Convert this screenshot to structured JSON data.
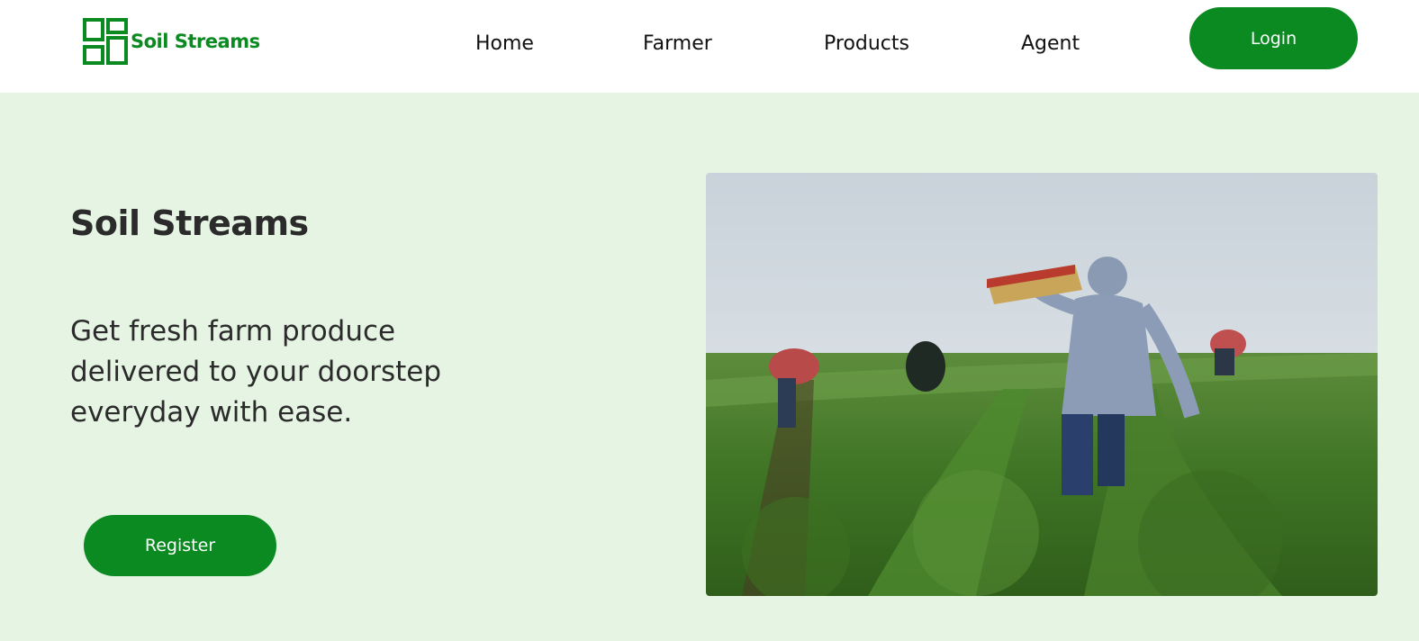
{
  "brand": {
    "name": "Soil Streams",
    "color": "#0b8a22",
    "logo_icon": "grid-blocks-icon"
  },
  "nav": {
    "items": [
      {
        "label": "Home"
      },
      {
        "label": "Farmer"
      },
      {
        "label": "Products"
      },
      {
        "label": "Agent"
      }
    ],
    "login_label": "Login"
  },
  "hero": {
    "title": "Soil Streams",
    "subtitle": "Get fresh farm produce delivered to your doorstep everyday with ease.",
    "register_label": "Register",
    "image_icon": "farm-workers-field-photo"
  },
  "colors": {
    "page_background": "#e5f4e3",
    "header_background": "#ffffff",
    "accent": "#0b8a22",
    "text": "#2b2b2b"
  }
}
